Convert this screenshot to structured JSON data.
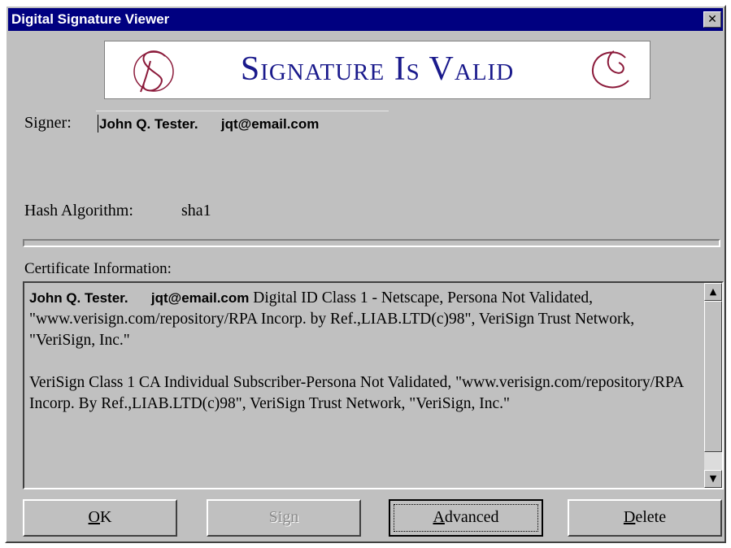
{
  "window": {
    "title": "Digital Signature Viewer",
    "close_symbol": "✕"
  },
  "banner": {
    "text": "Signature Is Valid",
    "left_glyph": "ornate-s-icon",
    "right_glyph": "ornate-c-icon",
    "color": "#1a1a8c"
  },
  "signer": {
    "label": "Signer:",
    "value": "John Q. Tester.      jqt@email.com"
  },
  "hash": {
    "label": "Hash Algorithm:",
    "value": "sha1"
  },
  "certificate": {
    "label": "Certificate Information:",
    "head": "John Q. Tester.      jqt@email.com",
    "para1_rest": " Digital ID Class 1 - Netscape, Persona Not Validated, \"www.verisign.com/repository/RPA Incorp. by Ref.,LIAB.LTD(c)98\", VeriSign Trust Network, \"VeriSign, Inc.\"",
    "para2": "VeriSign Class 1 CA Individual Subscriber-Persona Not Validated, \"www.verisign.com/repository/RPA Incorp. By Ref.,LIAB.LTD(c)98\", VeriSign Trust Network, \"VeriSign, Inc.\""
  },
  "buttons": {
    "ok": {
      "first": "O",
      "rest": "K"
    },
    "sign": {
      "label": "Sign"
    },
    "advanced": {
      "first": "A",
      "rest": "dvanced"
    },
    "delete": {
      "first": "D",
      "rest": "elete"
    }
  },
  "colors": {
    "titlebar": "#000080",
    "face": "#c0c0c0"
  }
}
